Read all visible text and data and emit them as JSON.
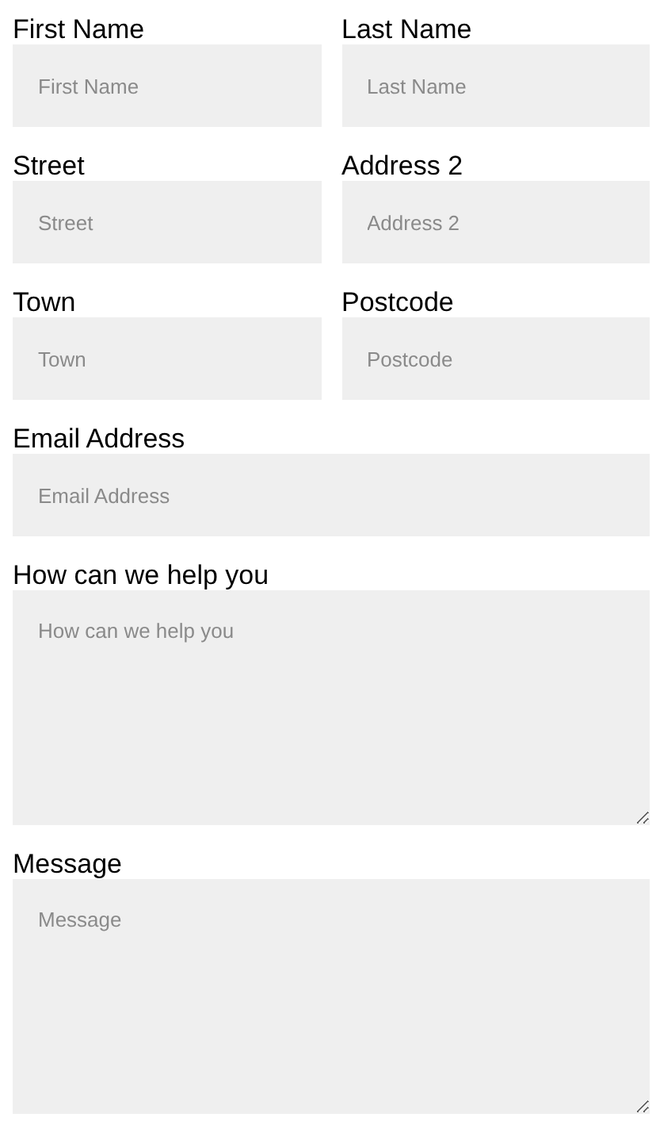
{
  "rows": [
    {
      "fields": [
        {
          "kind": "input",
          "label": "First Name",
          "placeholder": "First Name"
        },
        {
          "kind": "input",
          "label": "Last Name",
          "placeholder": "Last Name"
        }
      ]
    },
    {
      "fields": [
        {
          "kind": "input",
          "label": "Street",
          "placeholder": "Street"
        },
        {
          "kind": "input",
          "label": "Address 2",
          "placeholder": "Address 2"
        }
      ]
    },
    {
      "fields": [
        {
          "kind": "input",
          "label": "Town",
          "placeholder": "Town"
        },
        {
          "kind": "input",
          "label": "Postcode",
          "placeholder": "Postcode"
        }
      ]
    },
    {
      "fields": [
        {
          "kind": "input",
          "label": "Email Address",
          "placeholder": "Email Address"
        }
      ]
    },
    {
      "fields": [
        {
          "kind": "textarea",
          "label": "How can we help you",
          "placeholder": "How can we help you"
        }
      ]
    },
    {
      "fields": [
        {
          "kind": "textarea",
          "label": "Message",
          "placeholder": "Message"
        }
      ]
    }
  ]
}
